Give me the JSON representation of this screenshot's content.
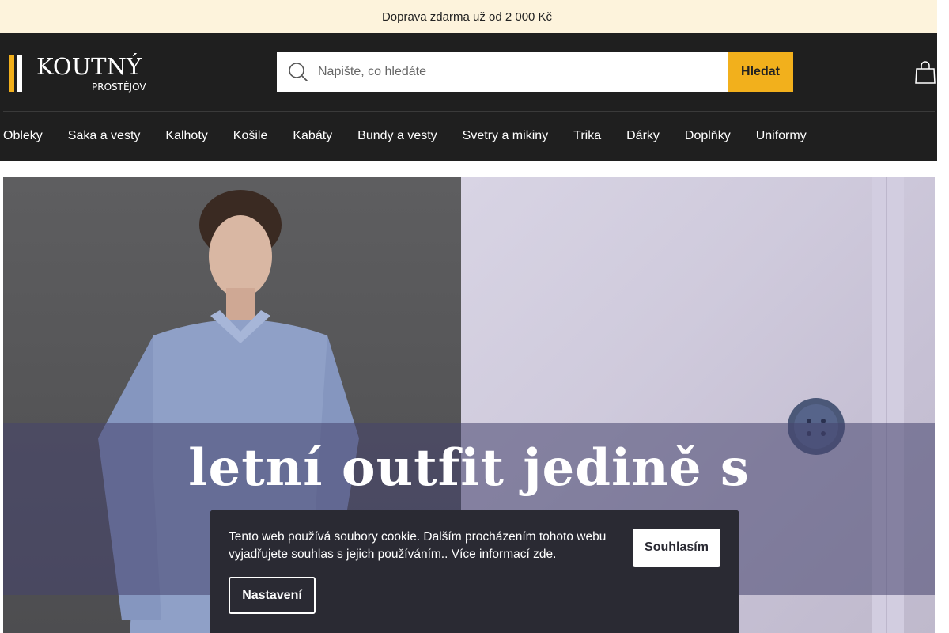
{
  "topbar": {
    "text": "Doprava zdarma už od 2 000 Kč",
    "arrow_glyph": "",
    "close_glyph": ""
  },
  "logo": {
    "name": "KOUTNÝ",
    "place": "PROSTĚJOV",
    "accent_color": "#f2b01c"
  },
  "search": {
    "placeholder": "Napište, co hledáte",
    "button_label": "Hledat"
  },
  "nav": {
    "items": [
      "Obleky",
      "Saka a vesty",
      "Kalhoty",
      "Košile",
      "Kabáty",
      "Bundy a vesty",
      "Svetry a mikiny",
      "Trika",
      "Dárky",
      "Doplňky",
      "Uniformy"
    ],
    "more_glyph": ""
  },
  "hero": {
    "headline": "letní outfit jedině s"
  },
  "cookie": {
    "text": "Tento web používá soubory cookie. Dalším procházením tohoto webu vyjadřujete souhlas s jejich používáním.. Více informací",
    "link_label": "zde",
    "link_suffix": ".",
    "accept_label": "Souhlasím",
    "settings_label": "Nastavení"
  },
  "colors": {
    "header_bg": "#1f1f1f",
    "topbar_bg": "#fdf3dc",
    "accent": "#f2b01c",
    "cookie_bg": "#2a2a33"
  }
}
